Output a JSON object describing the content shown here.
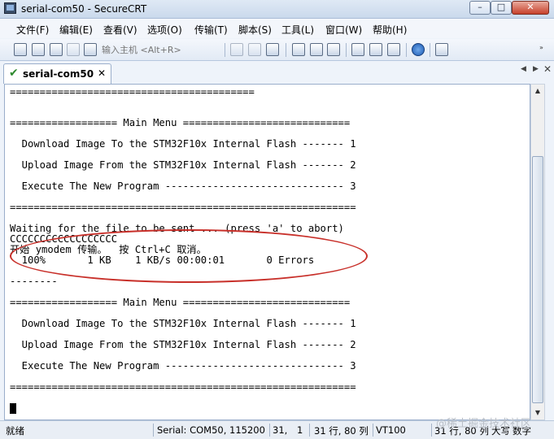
{
  "window": {
    "title": "serial-com50 - SecureCRT",
    "controls": {
      "minimize": "–",
      "maximize": "□",
      "close": "✕"
    }
  },
  "menubar": [
    {
      "label": "文件(F)"
    },
    {
      "label": "编辑(E)"
    },
    {
      "label": "查看(V)"
    },
    {
      "label": "选项(O)"
    },
    {
      "label": "传输(T)"
    },
    {
      "label": "脚本(S)"
    },
    {
      "label": "工具(L)"
    },
    {
      "label": "窗口(W)"
    },
    {
      "label": "帮助(H)"
    }
  ],
  "toolbar": {
    "quick_connect_placeholder": "输入主机 <Alt+R>",
    "overflow_chevron": "»",
    "icons": [
      "connect-icon",
      "quick-connect-icon",
      "connect-tab-icon",
      "reconnect-icon",
      "disconnect-icon",
      "copy-icon",
      "paste-icon",
      "find-icon",
      "print-setup-icon",
      "print-icon",
      "printer-icon",
      "session-options-icon",
      "global-options-icon",
      "keymap-icon",
      "help-icon",
      "sftp-icon"
    ]
  },
  "tabs": [
    {
      "label": "serial-com50",
      "status_icon": "✔",
      "close": "✕"
    }
  ],
  "tab_nav": {
    "left": "◀",
    "right": "▶",
    "close": "✕"
  },
  "terminal": {
    "lines": [
      "=========================================",
      "",
      "================== Main Menu ============================",
      "",
      "  Download Image To the STM32F10x Internal Flash ------- 1",
      "",
      "  Upload Image From the STM32F10x Internal Flash ------- 2",
      "",
      "  Execute The New Program ------------------------------ 3",
      "",
      "==========================================================",
      "",
      "Waiting for the file to be sent ... (press 'a' to abort)",
      "CCCCCCCCCCCCCCCCCC",
      "开始 ymodem 传输。  按 Ctrl+C 取消。",
      "  100%       1 KB    1 KB/s 00:00:01       0 Errors",
      "",
      "--------",
      "",
      "================== Main Menu ============================",
      "",
      "  Download Image To the STM32F10x Internal Flash ------- 1",
      "",
      "  Upload Image From the STM32F10x Internal Flash ------- 2",
      "",
      "  Execute The New Program ------------------------------ 3",
      "",
      "=========================================================="
    ]
  },
  "scrollbar": {
    "up": "▲",
    "down": "▼"
  },
  "statusbar": {
    "ready": "就绪",
    "connection": "Serial: COM50, 115200",
    "row": "31,",
    "col": "1",
    "size": "31 行, 80 列",
    "emulation": "VT100",
    "position": "31 行, 80 列",
    "caps": "大写",
    "num": "数字"
  },
  "watermark": "@稀土掘金技术社区"
}
